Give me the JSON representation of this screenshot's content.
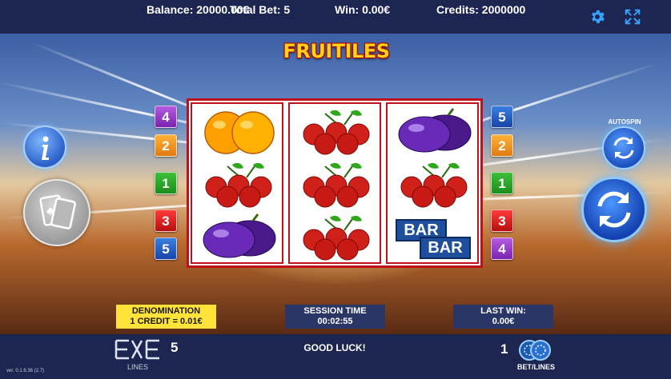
{
  "topbar": {
    "balance_label": "Balance:",
    "balance_value": "20000.00€",
    "total_bet_label": "Total Bet:",
    "total_bet_value": "5",
    "win_label": "Win:",
    "win_value": "0.00€",
    "credits_label": "Credits:",
    "credits_value": "2000000",
    "icons": [
      "gear-icon",
      "fullscreen-icon"
    ]
  },
  "game": {
    "title": "FRUITILES",
    "reels": [
      [
        "orange",
        "cherries",
        "plum"
      ],
      [
        "cherries",
        "cherries",
        "cherries"
      ],
      [
        "plum",
        "cherries",
        "bar"
      ]
    ],
    "bar_symbol_text": "BAR",
    "left_lines": [
      "4",
      "2",
      "1",
      "3",
      "5"
    ],
    "right_lines": [
      "5",
      "2",
      "1",
      "3",
      "4"
    ]
  },
  "controls": {
    "autospin_label": "AUTOSPIN",
    "info_icon": "info-icon",
    "cards_icon": "playing-cards-icon",
    "spin_icon": "spin-arrows-icon"
  },
  "info_panels": {
    "denomination_label": "DENOMINATION",
    "denomination_value": "1 CREDIT = 0.01€",
    "session_label": "SESSION TIME",
    "session_value": "00:02:55",
    "last_win_label": "LAST WIN:",
    "last_win_value": "0.00€"
  },
  "bottombar": {
    "lines_value": "5",
    "lines_label": "LINES",
    "message": "GOOD LUCK!",
    "bet_value": "1",
    "bet_label": "BET/LINES",
    "version": "ver. 0.1.6.36 (2.7)"
  },
  "colors": {
    "bar_bg": "#1c2650",
    "reel_border": "#c0101a",
    "denomination_bg": "#ffe23a",
    "accent_blue": "#2a7fe0"
  }
}
